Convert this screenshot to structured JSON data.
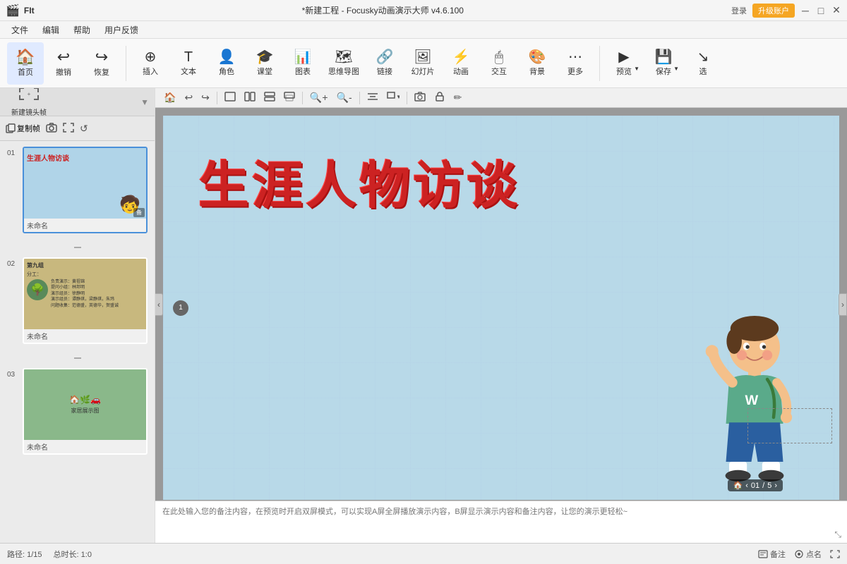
{
  "titlebar": {
    "title": "*新建工程 - Focusky动画演示大师  v4.6.100",
    "login_label": "登录",
    "upgrade_label": "升级账户",
    "icons": [
      "minimize",
      "maximize",
      "close"
    ]
  },
  "menubar": {
    "items": [
      "文件",
      "编辑",
      "帮助",
      "用户反馈"
    ]
  },
  "toolbar": {
    "groups": [
      {
        "buttons": [
          {
            "label": "首页",
            "icon": "🏠"
          },
          {
            "label": "撤销",
            "icon": "↩"
          },
          {
            "label": "恢复",
            "icon": "↪"
          }
        ]
      },
      {
        "buttons": [
          {
            "label": "插入",
            "icon": "➕"
          },
          {
            "label": "文本",
            "icon": "📝"
          },
          {
            "label": "角色",
            "icon": "👤"
          },
          {
            "label": "课堂",
            "icon": "🏫"
          },
          {
            "label": "图表",
            "icon": "📊"
          },
          {
            "label": "思维导图",
            "icon": "🗺"
          },
          {
            "label": "链接",
            "icon": "🔗"
          },
          {
            "label": "幻灯片",
            "icon": "🖼"
          },
          {
            "label": "动画",
            "icon": "✨"
          },
          {
            "label": "交互",
            "icon": "🎯"
          },
          {
            "label": "背景",
            "icon": "🖼"
          },
          {
            "label": "更多",
            "icon": "⋯"
          },
          {
            "label": "预览",
            "icon": "▶"
          },
          {
            "label": "保存",
            "icon": "💾"
          },
          {
            "label": "选",
            "icon": "↘"
          }
        ]
      }
    ]
  },
  "sidebar": {
    "new_frame_label": "新建镜头帧",
    "tools": [
      "复制帧",
      "📷",
      "⛶",
      "↺"
    ],
    "frames": [
      {
        "number": "01",
        "label": "未命名",
        "selected": true,
        "bg": "#b8d9e8",
        "type": "title"
      },
      {
        "number": "02",
        "label": "未命名",
        "selected": false,
        "bg": "#c8b060",
        "type": "text"
      },
      {
        "number": "03",
        "label": "未命名",
        "selected": false,
        "bg": "#7aaa7a",
        "type": "image"
      }
    ]
  },
  "slide": {
    "title": "生涯人物访谈",
    "frame_number": "1",
    "background_color": "#b8d9e8"
  },
  "canvas_toolbar": {
    "tools": [
      "🏠",
      "⟳",
      "⟳",
      "⬜",
      "⬜",
      "⬜",
      "⬜",
      "🔍+",
      "🔍-",
      "|",
      "⬜",
      "⬜+",
      "⬜",
      "📷",
      "⬛",
      "✏"
    ]
  },
  "notes": {
    "placeholder": "在此处输入您的备注内容，在预览时开启双屏模式，可以实现A屏全屏播放演示内容，B屏显示演示内容和备注内容，让您的演示更轻松~"
  },
  "statusbar": {
    "path": "路径: 1/15",
    "duration": "总时长: 1:0",
    "notes_label": "备注",
    "points_label": "点名"
  },
  "counter": {
    "current": "01",
    "separator": "/",
    "total": "5"
  }
}
